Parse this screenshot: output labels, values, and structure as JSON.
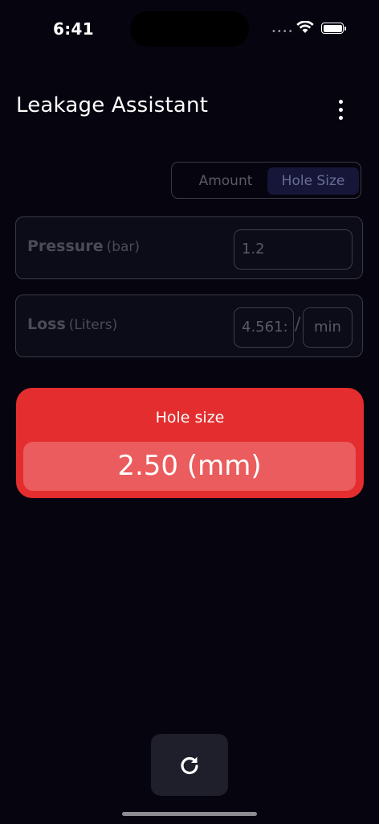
{
  "status_bar": {
    "time": "6:41",
    "signal_icon": "signal-dots",
    "wifi_icon": "wifi-icon",
    "battery_icon": "battery-full-icon"
  },
  "header": {
    "title": "Leakage Assistant",
    "menu_icon": "more-vertical-icon"
  },
  "mode_toggle": {
    "options": [
      "Amount",
      "Hole Size"
    ],
    "selected": "Hole Size"
  },
  "pressure": {
    "label": "Pressure",
    "unit": "(bar)",
    "value": "1.2"
  },
  "loss": {
    "label": "Loss",
    "unit": "(Liters)",
    "value": "4.561:",
    "separator": "/",
    "per": "min"
  },
  "result": {
    "label": "Hole size",
    "value": "2.50 (mm)"
  },
  "reset_button": {
    "icon": "refresh-icon"
  },
  "colors": {
    "background": "#05040f",
    "accent_red": "#e32d2e",
    "result_box": "#ea5c5d",
    "selected_segment": "#151638"
  }
}
